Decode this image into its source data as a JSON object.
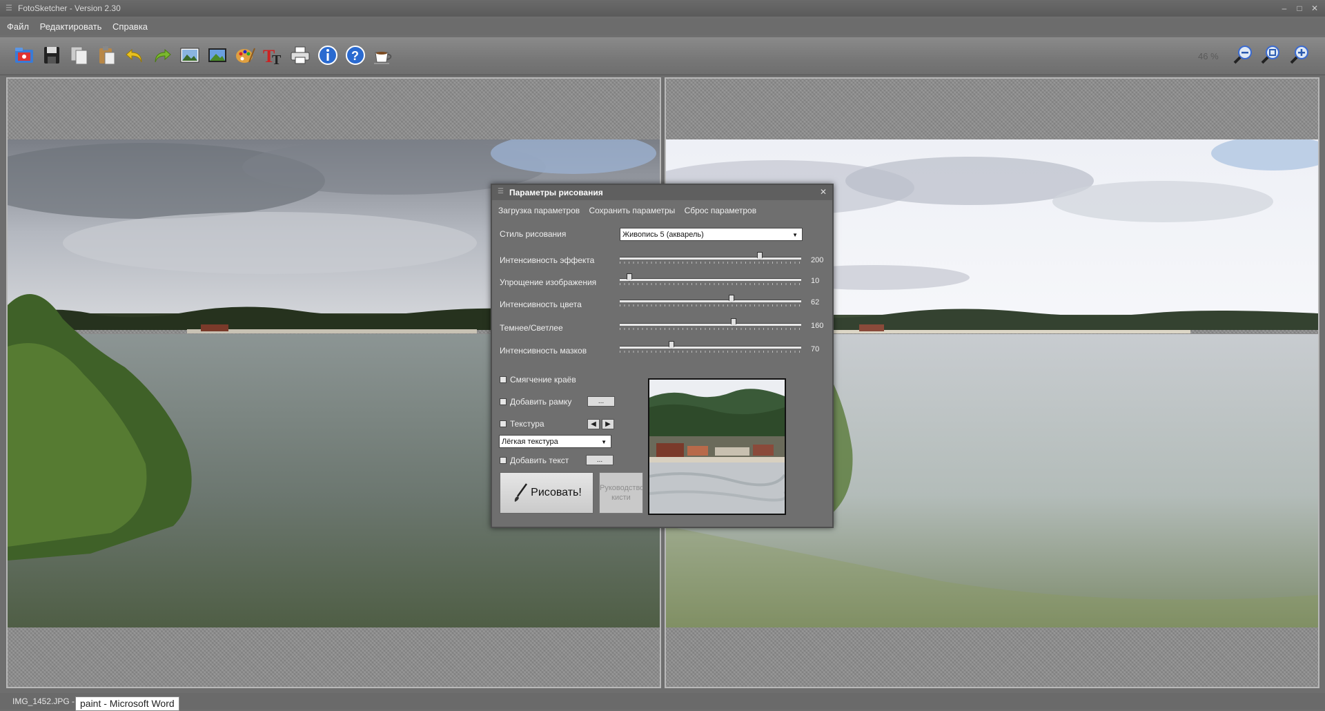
{
  "window": {
    "title": "FotoSketcher - Version 2.30"
  },
  "menu": [
    "Файл",
    "Редактировать",
    "Справка"
  ],
  "toolbar": {
    "icons": [
      "open-icon",
      "save-icon",
      "copy-icon",
      "paste-icon",
      "undo-icon",
      "redo-icon",
      "load-picture-icon",
      "landscape-icon",
      "palette-icon",
      "text-icon",
      "print-icon",
      "info-icon",
      "help-icon",
      "coffee-icon"
    ],
    "zoom_level": "46 %",
    "zoom_icons": [
      "zoom-out-icon",
      "zoom-fit-icon",
      "zoom-in-icon"
    ]
  },
  "dialog": {
    "title": "Параметры рисования",
    "links": [
      "Загрузка параметров",
      "Сохранить параметры",
      "Сброс параметров"
    ],
    "style_label": "Стиль рисования",
    "style_value": "Живопись 5 (акварель)",
    "sliders": [
      {
        "label": "Интенсивность эффекта",
        "value": "200",
        "fraction": 0.78
      },
      {
        "label": "Упрощение изображения",
        "value": "10",
        "fraction": 0.04
      },
      {
        "label": "Интенсивность цвета",
        "value": "62",
        "fraction": 0.62
      },
      {
        "label": "Темнее/Светлее",
        "value": "160",
        "fraction": 0.63
      },
      {
        "label": "Интенсивность мазков",
        "value": "70",
        "fraction": 0.28
      }
    ],
    "checkboxes": {
      "soften_edges": "Смягчение краёв",
      "add_frame": "Добавить рамку",
      "texture": "Текстура",
      "add_text": "Добавить текст"
    },
    "ellipsis": "...",
    "texture_value": "Лёгкая текстура",
    "draw_button": "Рисовать!",
    "guide_button": "Руководство\nкисти"
  },
  "status": {
    "filename": "IMG_1452.JPG -",
    "tooltip": "paint - Microsoft Word"
  }
}
